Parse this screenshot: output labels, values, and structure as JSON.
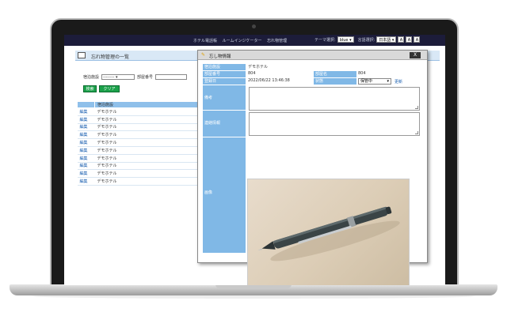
{
  "topbar": {
    "menu": [
      "ホテル電話帳",
      "ルームインジケーター",
      "忘れ物管理"
    ],
    "theme_label": "テーマ選択:",
    "theme_value": "blue",
    "lang_label": "言語選択:",
    "lang_value": "日本語",
    "font_buttons": [
      "A",
      "A",
      "A"
    ]
  },
  "page": {
    "title": "忘れ物管理の一覧",
    "search": {
      "facility_label": "宿泊施設",
      "facility_value": "--------",
      "room_label": "部屋番号"
    },
    "buttons": {
      "search": "検索",
      "clear": "クリア"
    },
    "list_header": "宿泊施設",
    "rows": [
      {
        "edit": "編集",
        "facility": "デモホテル"
      },
      {
        "edit": "編集",
        "facility": "デモホテル"
      },
      {
        "edit": "編集",
        "facility": "デモホテル"
      },
      {
        "edit": "編集",
        "facility": "デモホテル"
      },
      {
        "edit": "編集",
        "facility": "デモホテル"
      },
      {
        "edit": "編集",
        "facility": "デモホテル"
      },
      {
        "edit": "編集",
        "facility": "デモホテル"
      },
      {
        "edit": "編集",
        "facility": "デモホテル"
      },
      {
        "edit": "編集",
        "facility": "デモホテル"
      },
      {
        "edit": "編集",
        "facility": "デモホテル"
      }
    ]
  },
  "modal": {
    "title": "忘し物情報",
    "close": "X",
    "fields": {
      "facility_label": "宿泊施設",
      "facility_value": "デモホテル",
      "room_no_label": "部屋番号",
      "room_no_value": "804",
      "room_name_label": "部屋名",
      "room_name_value": "804",
      "reg_date_label": "登録日",
      "reg_date_value": "2022/06/22 13:46:38",
      "status_label": "状態",
      "status_value": "保管中",
      "update_link": "更新",
      "remarks_label": "備考",
      "contact_label": "連絡情報",
      "image_label": "画像"
    }
  },
  "colors": {
    "topbar_bg": "#1c1c3a",
    "label_bg": "#80b8e6",
    "button_green": "#1ba14a",
    "link_blue": "#1a5fb0"
  }
}
